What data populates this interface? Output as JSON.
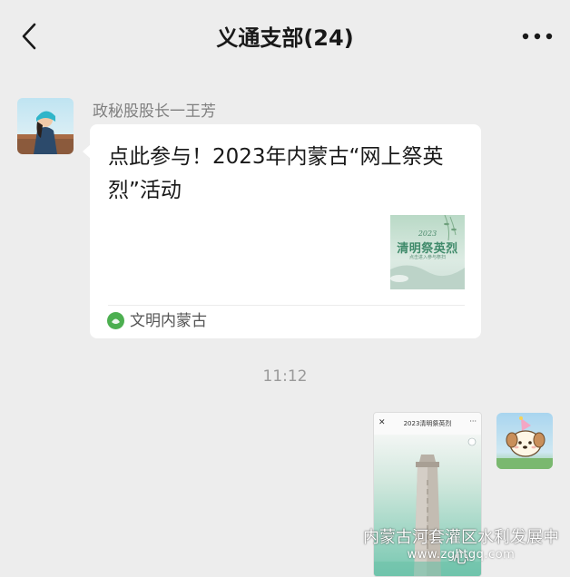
{
  "header": {
    "title": "义通支部(24)",
    "back_icon": "chevron-left-icon",
    "more_icon": "more-dots-icon"
  },
  "messages": [
    {
      "sender": "政秘股股长一王芳",
      "side": "left",
      "type": "link-card",
      "card": {
        "title": "点此参与！2023年内蒙古“网上祭英烈”活动",
        "thumbnail_text": {
          "year": "2023",
          "heading": "清明祭英烈",
          "subtitle": "点击进入参与祭扫"
        },
        "source": "文明内蒙古"
      }
    },
    {
      "type": "timestamp",
      "text": "11:12"
    },
    {
      "side": "right",
      "type": "image",
      "image": {
        "title": "2023清明祭英烈",
        "close_glyph": "✕",
        "more_glyph": "···"
      }
    }
  ],
  "watermark": {
    "text": "内蒙古河套灌区水利发展中心",
    "url": "www.zghtgq.com"
  },
  "colors": {
    "background": "#ededed",
    "bubble": "#ffffff",
    "sender_name": "#7f7f7f",
    "timestamp": "#9a9a9a",
    "source_icon": "#4caf50"
  }
}
